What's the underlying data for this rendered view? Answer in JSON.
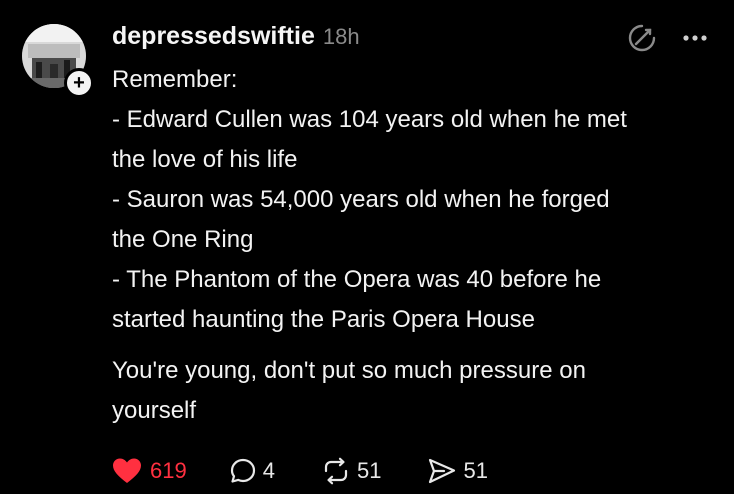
{
  "post": {
    "username": "depressedswiftie",
    "timestamp": "18h",
    "follow_symbol": "+",
    "lines": [
      "Remember:",
      "- Edward Cullen was 104 years old when he met",
      "the love of his life",
      "- Sauron was 54,000 years old when he forged",
      "the One Ring",
      "- The Phantom of the Opera was 40 before he",
      "started haunting the Paris Opera House"
    ],
    "closing_lines": [
      "You're young, don't put so much pressure on",
      "yourself"
    ]
  },
  "actions": {
    "likes": "619",
    "replies": "4",
    "reposts": "51",
    "shares": "51"
  },
  "colors": {
    "background": "#000000",
    "text": "#f3f3f3",
    "muted": "#8a8a8a",
    "like": "#ff3040"
  },
  "icons": {
    "ai": "translate-icon",
    "more": "more-icon",
    "like": "heart-icon",
    "reply": "reply-icon",
    "repost": "repost-icon",
    "share": "share-icon"
  }
}
